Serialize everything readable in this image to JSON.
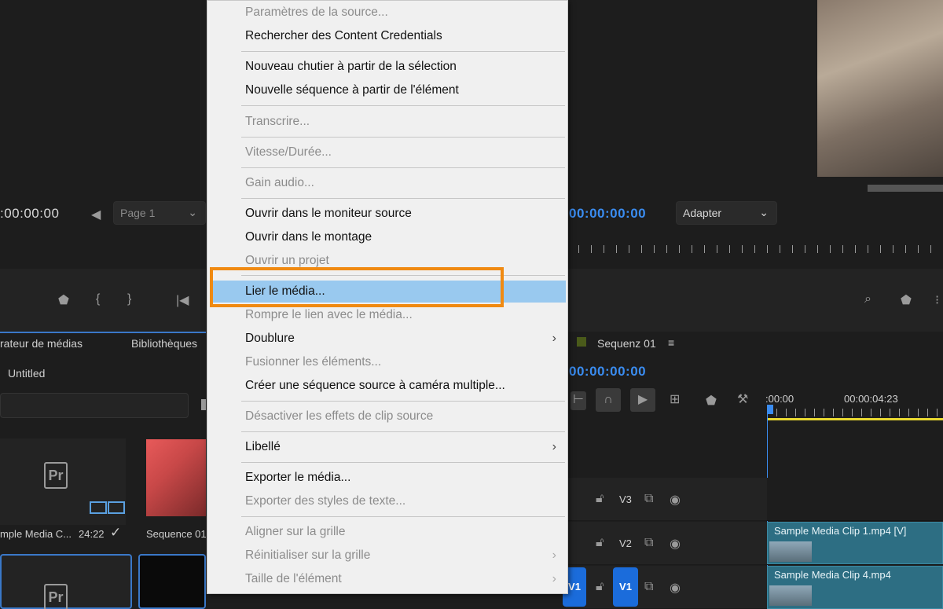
{
  "source_monitor": {
    "timecode": ":00:00:00",
    "page_dropdown": "Page 1"
  },
  "program_monitor": {
    "timecode": "00:00:00:00",
    "fit_dropdown": "Adapter"
  },
  "project_panel": {
    "tabs": [
      "rateur de médias",
      "Bibliothèques"
    ],
    "project_name": "Untitled",
    "items": [
      {
        "label": "mple Media C...",
        "duration": "24:22"
      },
      {
        "label": "Sequence 01"
      }
    ]
  },
  "timeline": {
    "sequence_name": "Sequenz 01",
    "timecode": "00:00:00:00",
    "ruler": [
      ":00:00",
      "00:00:04:23"
    ],
    "tracks": [
      {
        "label": "V3"
      },
      {
        "label": "V2",
        "clip": "Sample Media Clip 1.mp4 [V]"
      },
      {
        "label": "V1",
        "source_target": "V1",
        "clip": "Sample Media Clip 4.mp4"
      }
    ]
  },
  "context_menu": {
    "items": [
      {
        "label": "Paramètres de la source...",
        "enabled": false
      },
      {
        "label": "Rechercher des Content Credentials",
        "enabled": true
      },
      {
        "label": "Nouveau chutier à partir de la sélection",
        "enabled": true
      },
      {
        "label": "Nouvelle séquence à partir de l'élément",
        "enabled": true
      },
      {
        "label": "Transcrire...",
        "enabled": false
      },
      {
        "label": "Vitesse/Durée...",
        "enabled": false
      },
      {
        "label": "Gain audio...",
        "enabled": false
      },
      {
        "label": "Ouvrir dans le moniteur source",
        "enabled": true
      },
      {
        "label": "Ouvrir dans le montage",
        "enabled": true
      },
      {
        "label": "Ouvrir un projet",
        "enabled": false
      },
      {
        "label": "Lier le média...",
        "enabled": true,
        "highlighted": true
      },
      {
        "label": "Rompre le lien avec le média...",
        "enabled": false
      },
      {
        "label": "Doublure",
        "enabled": true,
        "submenu": true
      },
      {
        "label": "Fusionner les éléments...",
        "enabled": false
      },
      {
        "label": "Créer une séquence source à caméra multiple...",
        "enabled": true
      },
      {
        "label": "Désactiver les effets de clip source",
        "enabled": false
      },
      {
        "label": "Libellé",
        "enabled": true,
        "submenu": true
      },
      {
        "label": "Exporter le média...",
        "enabled": true
      },
      {
        "label": "Exporter des styles de texte...",
        "enabled": false
      },
      {
        "label": "Aligner sur la grille",
        "enabled": false
      },
      {
        "label": "Réinitialiser sur la grille",
        "enabled": false,
        "submenu": true
      },
      {
        "label": "Taille de l'élément",
        "enabled": false,
        "submenu": true
      }
    ],
    "submenu_arrow": "›"
  },
  "colors": {
    "highlight_outline": "#f08a12",
    "menu_hover": "#99c9ef",
    "timecode_blue": "#3a8cf0",
    "clip_teal": "#2d6e83"
  }
}
